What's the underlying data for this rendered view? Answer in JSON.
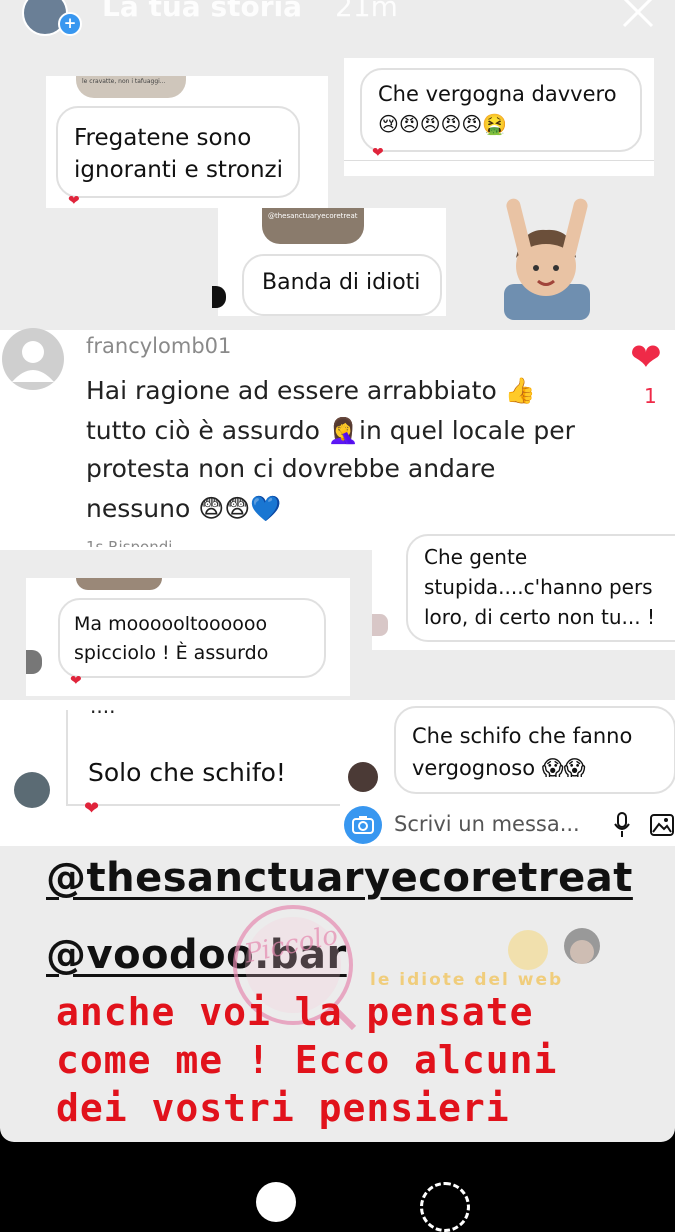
{
  "header": {
    "title": "La tua storia",
    "time": "21m"
  },
  "shots": {
    "s1_thumb_text": "le cravatte, non i tafuaggi...",
    "s1_text": "Fregatene sono ignoranti e stronzi",
    "s2_text": "Che vergogna davvero",
    "s2_emojis": "😢😠😠😠😠🤮",
    "s3_thumb_text": "@thesanctuaryecoretreat",
    "s3_text": "Banda di idioti",
    "comment_user": "francylomb01",
    "comment_text_1": "Hai ragione ad essere arrabbiato 👍",
    "comment_text_2": "tutto ciò è assurdo 🤦‍♀️in quel locale per",
    "comment_text_3": "protesta non ci dovrebbe andare",
    "comment_text_4": "nessuno 😨😨💙",
    "comment_like_count": "1",
    "comment_meta": "1s  Rispondi",
    "s5_text": "Che gente stupida....c'hanno pers loro, di certo non tu... !",
    "s6_text": "Ma moooooltoooooo spicciolo ! È assurdo",
    "s7_dots": "....",
    "s7_text": "Solo che schifo!",
    "s8_text": "Che schifo  che fanno vergognoso 😱😱",
    "message_placeholder": "Scrivi un messa..."
  },
  "tags": {
    "tag1": "@thesanctuaryecoretreat",
    "tag2": "@voodoo.bar"
  },
  "caption": {
    "line1": "anche voi la pensate",
    "line2": "come me ! Ecco alcuni",
    "line3": "dei vostri pensieri"
  },
  "watermark": {
    "text1": "Piccolo",
    "text2": "le idiote del web"
  },
  "icons": [
    "close-icon",
    "heart-icon",
    "camera-icon",
    "microphone-icon",
    "image-icon",
    "plus-icon"
  ],
  "colors": {
    "accent_red": "#e1121b",
    "heart": "#e0243b",
    "camera_blue": "#3897f0"
  }
}
